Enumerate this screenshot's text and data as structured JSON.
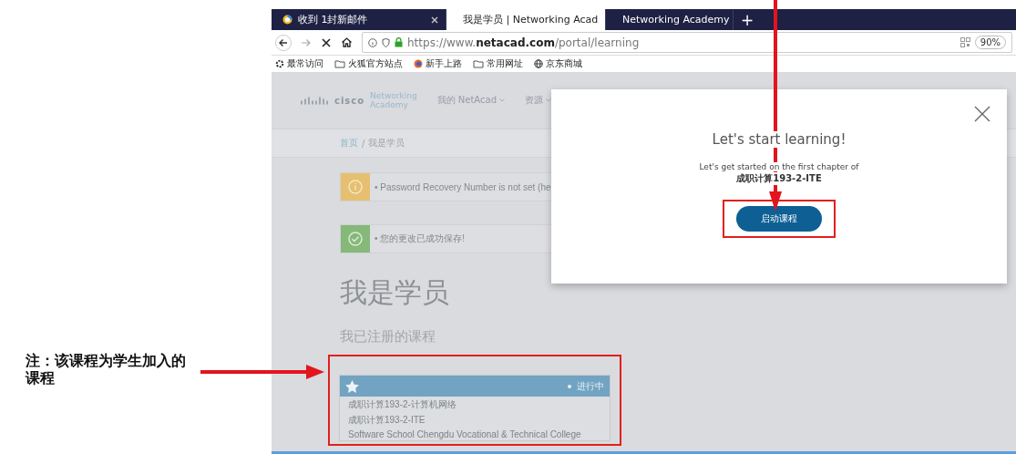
{
  "annotation": {
    "note": "注：该课程为学生加入的课程"
  },
  "browser": {
    "tabs": [
      {
        "title": "收到 1封新邮件",
        "selected": false
      },
      {
        "title": "我是学员 | Networking Acad",
        "selected": true
      },
      {
        "title": "Networking Academy",
        "selected": false
      }
    ],
    "new_tab": "+",
    "url": "https://www.**netacad.com**/portal/learning",
    "zoom": "90%",
    "bookmarks": [
      {
        "kind": "gear",
        "label": "最常访问"
      },
      {
        "kind": "folder",
        "label": "火狐官方站点"
      },
      {
        "kind": "browser",
        "label": "新手上路"
      },
      {
        "kind": "folder",
        "label": "常用网址"
      },
      {
        "kind": "globe",
        "label": "京东商城"
      }
    ]
  },
  "page": {
    "logo": {
      "brand": "cisco",
      "line1": "Networking",
      "line2": "Academy"
    },
    "nav": [
      "我的 NetAcad",
      "资源"
    ],
    "breadcrumb": {
      "link": "首页",
      "separator": "/",
      "current": "我是学员"
    },
    "alerts": [
      {
        "kind": "warning",
        "text": "• Password Recovery Number is not set (he"
      },
      {
        "kind": "success",
        "text": "• 您的更改已成功保存!"
      }
    ],
    "heading": "我是学员",
    "subheading": "我已注册的课程",
    "course": {
      "status": "进行中",
      "lines": [
        "成职计算193-2-计算机网络",
        "成职计算193-2-ITE",
        "Software School Chengdu Vocational & Technical College"
      ]
    }
  },
  "modal": {
    "title": "Let's start learning!",
    "body": "Let's get started on the first chapter of",
    "course": "成职计算193-2-ITE",
    "button": "启动课程"
  }
}
